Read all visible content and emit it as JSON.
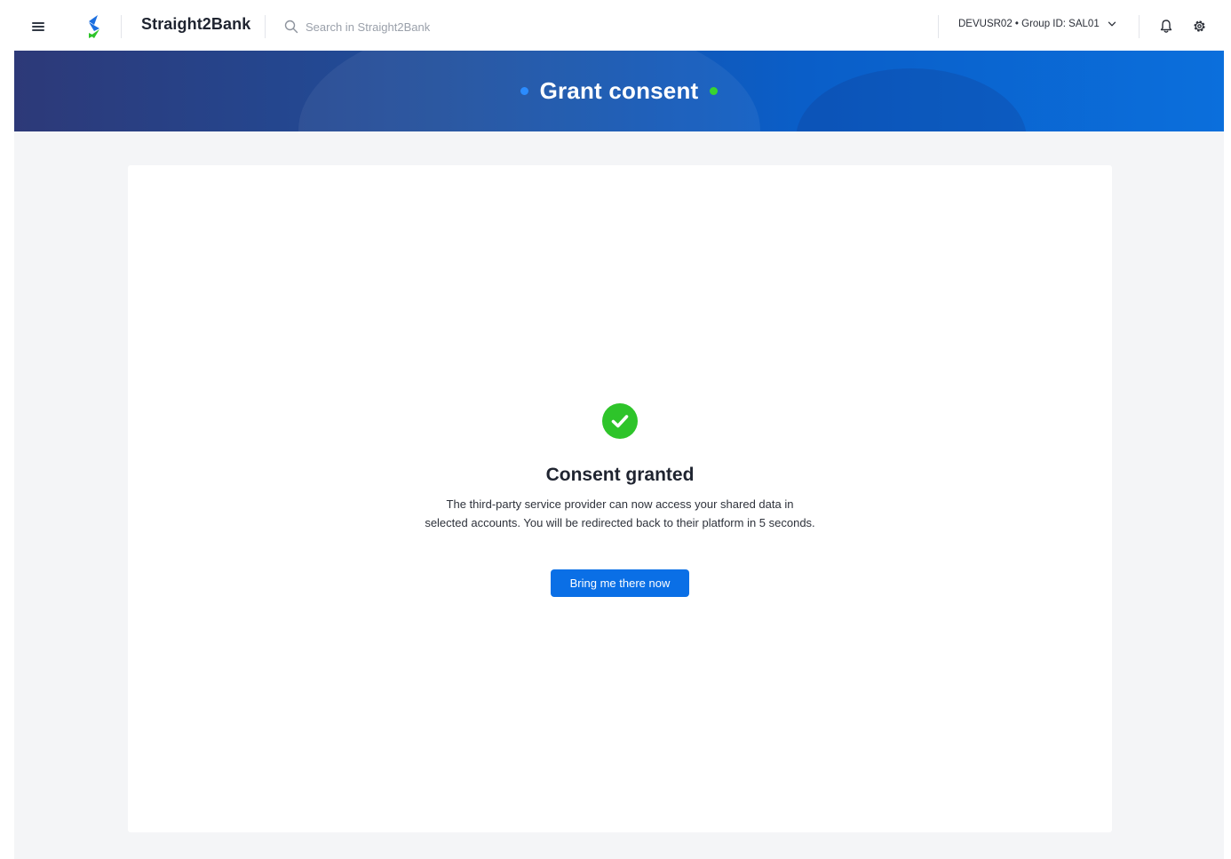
{
  "header": {
    "brand": "Straight2Bank",
    "search_placeholder": "Search in Straight2Bank",
    "user_selector": "DEVUSR02 • Group ID: SAL01",
    "icons": [
      "menu-icon",
      "bank-logo-icon",
      "search-icon",
      "chevron-down-icon",
      "bell-icon",
      "gear-icon"
    ]
  },
  "banner": {
    "title": "Grant consent"
  },
  "result": {
    "status_icon": "check-circle-icon",
    "title": "Consent granted",
    "message": "The third-party service provider can now access your shared data in selected accounts. You will be redirected back to their platform in 5 seconds.",
    "button_label": "Bring me there now"
  },
  "colors": {
    "accent": "#0a6fe6",
    "success": "#2ec42a",
    "banner_start": "#2d3978",
    "banner_end": "#0b6fdc"
  }
}
